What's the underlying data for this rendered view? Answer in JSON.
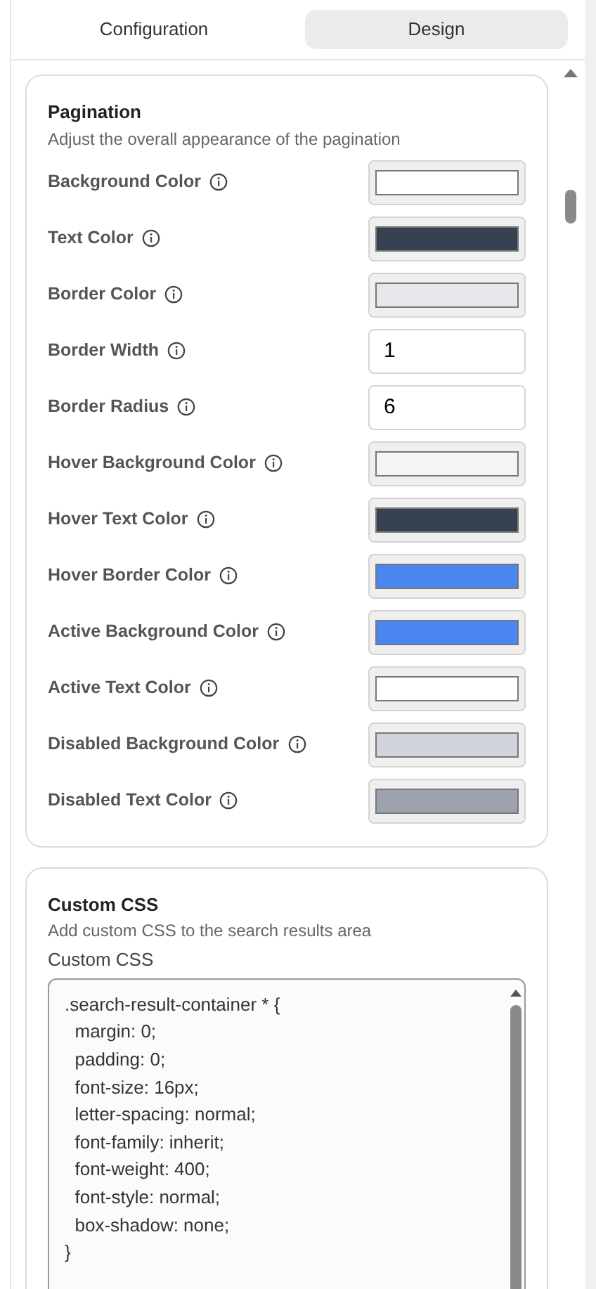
{
  "tabs": [
    {
      "label": "Configuration",
      "selected": false
    },
    {
      "label": "Design",
      "selected": true
    }
  ],
  "pagination": {
    "title": "Pagination",
    "description": "Adjust the overall appearance of the pagination",
    "fields": [
      {
        "label": "Background Color",
        "kind": "color",
        "color": "#ffffff"
      },
      {
        "label": "Text Color",
        "kind": "color",
        "color": "#374151"
      },
      {
        "label": "Border Color",
        "kind": "color",
        "color": "#e5e7eb"
      },
      {
        "label": "Border Width",
        "kind": "number",
        "value": "1"
      },
      {
        "label": "Border Radius",
        "kind": "number",
        "value": "6"
      },
      {
        "label": "Hover Background Color",
        "kind": "color",
        "color": "#f3f4f6"
      },
      {
        "label": "Hover Text Color",
        "kind": "color",
        "color": "#374151"
      },
      {
        "label": "Hover Border Color",
        "kind": "color",
        "color": "#4a86f0"
      },
      {
        "label": "Active Background Color",
        "kind": "color",
        "color": "#4a86f0"
      },
      {
        "label": "Active Text Color",
        "kind": "color",
        "color": "#ffffff"
      },
      {
        "label": "Disabled Background Color",
        "kind": "color",
        "color": "#d1d5db"
      },
      {
        "label": "Disabled Text Color",
        "kind": "color",
        "color": "#9ca3af"
      }
    ]
  },
  "custom_css": {
    "title": "Custom CSS",
    "description": "Add custom CSS to the search results area",
    "field_label": "Custom CSS",
    "value": ".search-result-container * {\n  margin: 0;\n  padding: 0;\n  font-size: 16px;\n  letter-spacing: normal;\n  font-family: inherit;\n  font-weight: 400;\n  font-style: normal;\n  box-shadow: none;\n}"
  }
}
